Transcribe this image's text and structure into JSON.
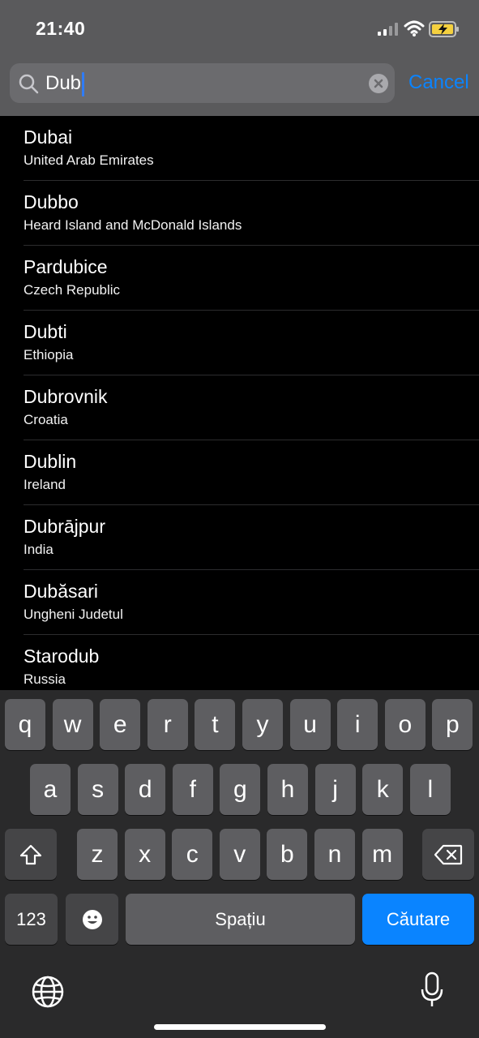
{
  "status_bar": {
    "time": "21:40",
    "signal_icon": "cellular-signal-icon",
    "wifi_icon": "wifi-icon",
    "battery_icon": "battery-charging-icon",
    "battery_color": "#f4d03f"
  },
  "search": {
    "value": "Dub",
    "cancel_label": "Cancel",
    "accent": "#0a84ff"
  },
  "results": [
    {
      "city": "Dubai",
      "country": "United Arab Emirates"
    },
    {
      "city": "Dubbo",
      "country": "Heard Island and McDonald Islands"
    },
    {
      "city": "Pardubice",
      "country": "Czech Republic"
    },
    {
      "city": "Dubti",
      "country": "Ethiopia"
    },
    {
      "city": "Dubrovnik",
      "country": "Croatia"
    },
    {
      "city": "Dublin",
      "country": "Ireland"
    },
    {
      "city": "Dubrājpur",
      "country": "India"
    },
    {
      "city": "Dubăsari",
      "country": "Ungheni Judetul"
    },
    {
      "city": "Starodub",
      "country": "Russia"
    }
  ],
  "keyboard": {
    "row1": [
      "q",
      "w",
      "e",
      "r",
      "t",
      "y",
      "u",
      "i",
      "o",
      "p"
    ],
    "row2": [
      "a",
      "s",
      "d",
      "f",
      "g",
      "h",
      "j",
      "k",
      "l"
    ],
    "row3": [
      "z",
      "x",
      "c",
      "v",
      "b",
      "n",
      "m"
    ],
    "numbers_label": "123",
    "space_label": "Spațiu",
    "search_label": "Căutare",
    "shift_icon": "shift-icon",
    "delete_icon": "backspace-icon",
    "emoji_icon": "emoji-icon",
    "globe_icon": "globe-icon",
    "mic_icon": "microphone-icon"
  }
}
